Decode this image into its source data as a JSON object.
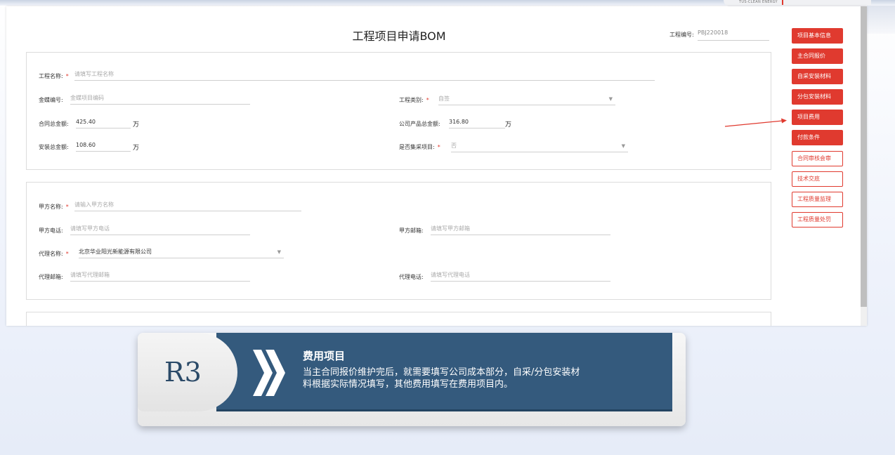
{
  "brand": {
    "logo_text": "TUS-CLEAN ENERGY",
    "accent": "#e03a2f"
  },
  "form": {
    "title": "工程项目申请BOM",
    "project_no_label": "工程编号:",
    "project_no_value": "PBJ220018",
    "section1": {
      "name_label": "工程名称:",
      "name_placeholder": "请填写工程名称",
      "kingdee_label": "金蝶编号:",
      "kingdee_placeholder": "金蝶项目编码",
      "type_label": "工程类别:",
      "type_value": "自签",
      "contract_total_label": "合同总金额:",
      "contract_total_value": "425.40",
      "product_total_label": "公司产品总金额:",
      "product_total_value": "316.80",
      "install_total_label": "安装总金额:",
      "install_total_value": "108.60",
      "centralized_label": "是否集采项目:",
      "centralized_value": "否",
      "unit": "万"
    },
    "section2": {
      "partyA_name_label": "甲方名称:",
      "partyA_name_placeholder": "请输入甲方名称",
      "partyA_phone_label": "甲方电话:",
      "partyA_phone_placeholder": "请填写甲方电话",
      "partyA_email_label": "甲方邮箱:",
      "partyA_email_placeholder": "请填写甲方邮箱",
      "agent_name_label": "代理名称:",
      "agent_name_value": "北京华业阳光新能源有限公司",
      "agent_email_label": "代理邮箱:",
      "agent_email_placeholder": "请填写代理邮箱",
      "agent_phone_label": "代理电话:",
      "agent_phone_placeholder": "请填写代理电话"
    }
  },
  "sidebar": {
    "items": [
      {
        "label": "项目基本信息",
        "style": "filled"
      },
      {
        "label": "主合同报价",
        "style": "filled"
      },
      {
        "label": "自采安装材料",
        "style": "filled"
      },
      {
        "label": "分包安装材料",
        "style": "filled"
      },
      {
        "label": "项目费用",
        "style": "filled"
      },
      {
        "label": "付款条件",
        "style": "filled"
      },
      {
        "label": "合同审核会审",
        "style": "outline"
      },
      {
        "label": "技术交底",
        "style": "outline"
      },
      {
        "label": "工程质量监理",
        "style": "outline"
      },
      {
        "label": "工程质量处罚",
        "style": "outline"
      }
    ]
  },
  "callout": {
    "badge": "R3",
    "title": "费用项目",
    "body": "当主合同报价维护完后，就需要填写公司成本部分，自采/分包安装材料根据实际情况填写，其他费用填写在费用项目内。"
  }
}
